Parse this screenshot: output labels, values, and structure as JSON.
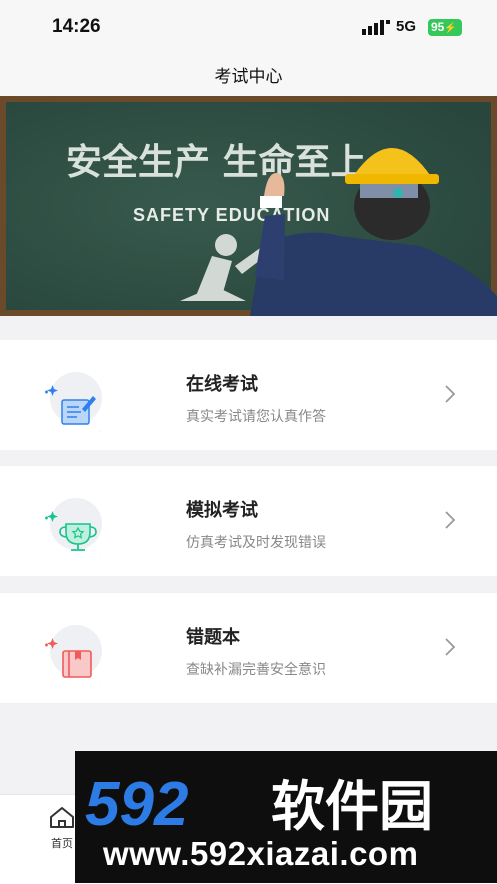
{
  "status_bar": {
    "time": "14:26",
    "network": "5G",
    "battery": "95"
  },
  "header": {
    "title": "考试中心"
  },
  "banner": {
    "headline": "安全生产 生命至上",
    "subline": "SAFETY EDUCATION"
  },
  "menu": [
    {
      "title": "在线考试",
      "subtitle": "真实考试请您认真作答",
      "icon": "notepad-edit-icon",
      "accent": "#2f80ed"
    },
    {
      "title": "模拟考试",
      "subtitle": "仿真考试及时发现错误",
      "icon": "trophy-icon",
      "accent": "#19c38f"
    },
    {
      "title": "错题本",
      "subtitle": "查缺补漏完善安全意识",
      "icon": "book-icon",
      "accent": "#f05a5a"
    }
  ],
  "tabbar": {
    "home_label": "首页"
  },
  "watermark": {
    "logo_text": "592软件园",
    "url": "www.592xiazai.com"
  }
}
